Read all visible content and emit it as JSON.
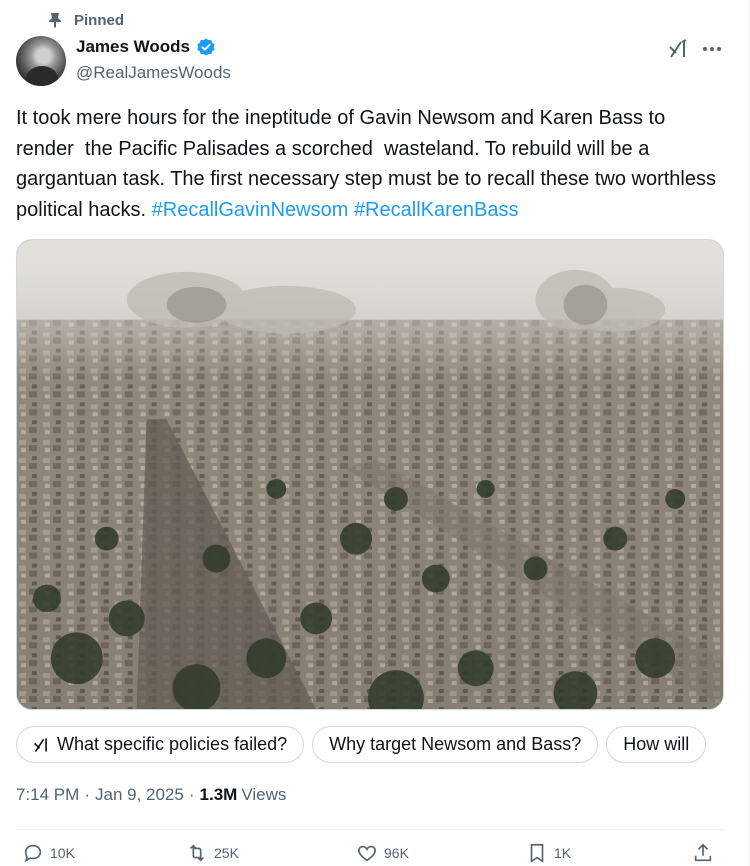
{
  "pinned_label": "Pinned",
  "author": {
    "name": "James Woods",
    "handle": "@RealJamesWoods",
    "verified": true
  },
  "tweet": {
    "text": "It took mere hours for the ineptitude of Gavin Newsom and Karen Bass to render  the Pacific Palisades a scorched  wasteland. To rebuild will be a gargantuan task. The first necessary step must be to recall these two worthless political hacks. ",
    "hashtags": [
      "#RecallGavinNewsom",
      "#RecallKarenBass"
    ]
  },
  "grok_suggestions": [
    "What specific policies failed?",
    "Why target Newsom and Bass?",
    "How will"
  ],
  "meta": {
    "time": "7:14 PM",
    "date": "Jan 9, 2025",
    "views_count": "1.3M",
    "views_label": "Views"
  },
  "actions": {
    "replies": "10K",
    "reposts": "25K",
    "likes": "96K",
    "bookmarks": "1K"
  },
  "colors": {
    "link": "#1d9bf0",
    "secondary_text": "#536471",
    "border": "#cfd9de"
  },
  "icons": [
    "pin-icon",
    "verified-badge-icon",
    "grok-icon",
    "more-icon",
    "reply-icon",
    "repost-icon",
    "like-icon",
    "bookmark-icon",
    "share-icon"
  ]
}
